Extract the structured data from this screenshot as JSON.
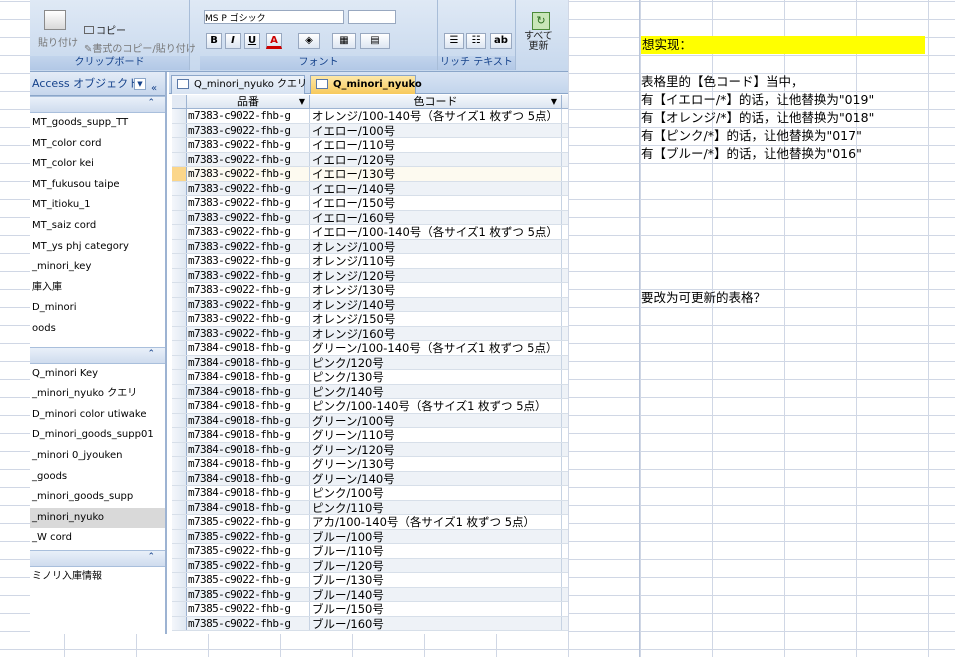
{
  "ribbon": {
    "paste_label": "貼り付け",
    "copy_label": "コピー",
    "format_painter_label": "書式のコピー/貼り付け",
    "clipboard_caption": "クリップボード",
    "font_caption": "フォント",
    "rich_text_caption": "リッチ テキスト",
    "refresh_label": "すべて\n更新",
    "font_name": "MS P ゴシック",
    "bold": "B",
    "italic": "I",
    "underline": "U",
    "font_color": "A"
  },
  "nav": {
    "title": "Access オブジェクト",
    "group1_items": [
      "MT_goods_supp_TT",
      "MT_color cord",
      "MT_color kei",
      "MT_fukusou taipe",
      "MT_itioku_1",
      "MT_saiz cord",
      "MT_ys phj category",
      "_minori_key",
      "庫入庫",
      "D_minori",
      "oods"
    ],
    "group2_items": [
      "Q_minori Key",
      "_minori_nyuko クエリ",
      "D_minori color utiwake",
      "D_minori_goods_supp01",
      "_minori 0_jyouken",
      "_goods",
      "_minori_goods_supp",
      "_minori_nyuko",
      "_W cord"
    ],
    "group3_items": [
      "ミノリ入庫情報"
    ]
  },
  "tabs": [
    "Q_minori_nyuko クエリ",
    "Q_minori_nyuko"
  ],
  "table": {
    "headers": [
      "品番",
      "色コード"
    ],
    "rows": [
      [
        "m7383-c9022-fhb-g",
        "オレンジ/100-140号（各サイズ1 枚ずつ 5点）"
      ],
      [
        "m7383-c9022-fhb-g",
        "イエロー/100号"
      ],
      [
        "m7383-c9022-fhb-g",
        "イエロー/110号"
      ],
      [
        "m7383-c9022-fhb-g",
        "イエロー/120号"
      ],
      [
        "m7383-c9022-fhb-g",
        "イエロー/130号"
      ],
      [
        "m7383-c9022-fhb-g",
        "イエロー/140号"
      ],
      [
        "m7383-c9022-fhb-g",
        "イエロー/150号"
      ],
      [
        "m7383-c9022-fhb-g",
        "イエロー/160号"
      ],
      [
        "m7383-c9022-fhb-g",
        "イエロー/100-140号（各サイズ1 枚ずつ 5点）"
      ],
      [
        "m7383-c9022-fhb-g",
        "オレンジ/100号"
      ],
      [
        "m7383-c9022-fhb-g",
        "オレンジ/110号"
      ],
      [
        "m7383-c9022-fhb-g",
        "オレンジ/120号"
      ],
      [
        "m7383-c9022-fhb-g",
        "オレンジ/130号"
      ],
      [
        "m7383-c9022-fhb-g",
        "オレンジ/140号"
      ],
      [
        "m7383-c9022-fhb-g",
        "オレンジ/150号"
      ],
      [
        "m7383-c9022-fhb-g",
        "オレンジ/160号"
      ],
      [
        "m7384-c9018-fhb-g",
        "グリーン/100-140号（各サイズ1 枚ずつ 5点）"
      ],
      [
        "m7384-c9018-fhb-g",
        "ピンク/120号"
      ],
      [
        "m7384-c9018-fhb-g",
        "ピンク/130号"
      ],
      [
        "m7384-c9018-fhb-g",
        "ピンク/140号"
      ],
      [
        "m7384-c9018-fhb-g",
        "ピンク/100-140号（各サイズ1 枚ずつ 5点）"
      ],
      [
        "m7384-c9018-fhb-g",
        "グリーン/100号"
      ],
      [
        "m7384-c9018-fhb-g",
        "グリーン/110号"
      ],
      [
        "m7384-c9018-fhb-g",
        "グリーン/120号"
      ],
      [
        "m7384-c9018-fhb-g",
        "グリーン/130号"
      ],
      [
        "m7384-c9018-fhb-g",
        "グリーン/140号"
      ],
      [
        "m7384-c9018-fhb-g",
        "ピンク/100号"
      ],
      [
        "m7384-c9018-fhb-g",
        "ピンク/110号"
      ],
      [
        "m7385-c9022-fhb-g",
        "アカ/100-140号（各サイズ1 枚ずつ 5点）"
      ],
      [
        "m7385-c9022-fhb-g",
        "ブルー/100号"
      ],
      [
        "m7385-c9022-fhb-g",
        "ブルー/110号"
      ],
      [
        "m7385-c9022-fhb-g",
        "ブルー/120号"
      ],
      [
        "m7385-c9022-fhb-g",
        "ブルー/130号"
      ],
      [
        "m7385-c9022-fhb-g",
        "ブルー/140号"
      ],
      [
        "m7385-c9022-fhb-g",
        "ブルー/150号"
      ],
      [
        "m7385-c9022-fhb-g",
        "ブルー/160号"
      ]
    ]
  },
  "excel": {
    "title": "想实现：",
    "intro": "表格里的【色コード】当中，",
    "rules": [
      "有【イエロー/*】的话，让他替换为\"019\"",
      "有【オレンジ/*】的话，让他替换为\"018\"",
      "有【ピンク/*】的话，让他替换为\"017\"",
      "有【ブルー/*】的话，让他替换为\"016\""
    ],
    "question": "要改为可更新的表格？"
  }
}
